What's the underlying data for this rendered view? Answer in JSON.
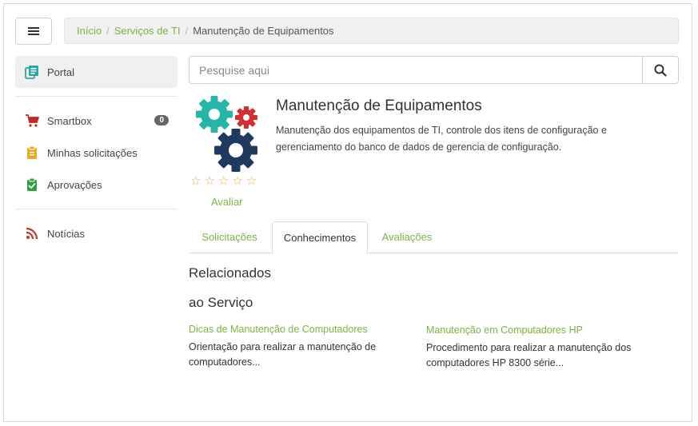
{
  "breadcrumb": {
    "items": [
      "Início",
      "Serviços de TI"
    ],
    "separator": "/",
    "current": "Manutenção de Equipamentos"
  },
  "sidebar": {
    "items": [
      {
        "label": "Portal",
        "icon": "portal-icon",
        "color": "#2aa7a1"
      },
      {
        "label": "Smartbox",
        "icon": "cart-icon",
        "color": "#c62828",
        "badge": "0"
      },
      {
        "label": "Minhas solicitações",
        "icon": "clipboard-icon",
        "color": "#f0a81d"
      },
      {
        "label": "Aprovações",
        "icon": "clipboard-check-icon",
        "color": "#2e9e3e"
      },
      {
        "label": "Notícias",
        "icon": "rss-icon",
        "color": "#c0392b"
      }
    ]
  },
  "search": {
    "placeholder": "Pesquise aqui",
    "value": "",
    "icon": "search-icon"
  },
  "service": {
    "title": "Manutenção de Equipamentos",
    "description": "Manutenção dos equipamentos de TI, controle dos itens de configuração e gerenciamento do banco de dados de gerencia de configuração.",
    "image": "gears-icon",
    "rating_stars": [
      "☆",
      "☆",
      "☆",
      "☆",
      "☆"
    ],
    "rating_value": 0,
    "rate_label": "Avaliar"
  },
  "tabs": [
    {
      "label": "Solicitações",
      "active": false
    },
    {
      "label": "Conhecimentos",
      "active": true
    },
    {
      "label": "Avaliações",
      "active": false
    }
  ],
  "related": {
    "heading1": "Relacionados",
    "heading2": "ao Serviço",
    "articles": [
      {
        "title": "Dicas de Manutenção de Computadores",
        "description": "Orientação para realizar a manutenção de computadores..."
      },
      {
        "title": "Manutenção em Computadores HP",
        "description": "Procedimento para realizar a manutenção dos computadores HP 8300 série..."
      }
    ]
  },
  "colors": {
    "accent": "#7cb342",
    "gear_teal": "#26b5a6",
    "gear_red": "#d32f2f",
    "gear_navy": "#1e3a5f",
    "star": "#e0b43a"
  }
}
